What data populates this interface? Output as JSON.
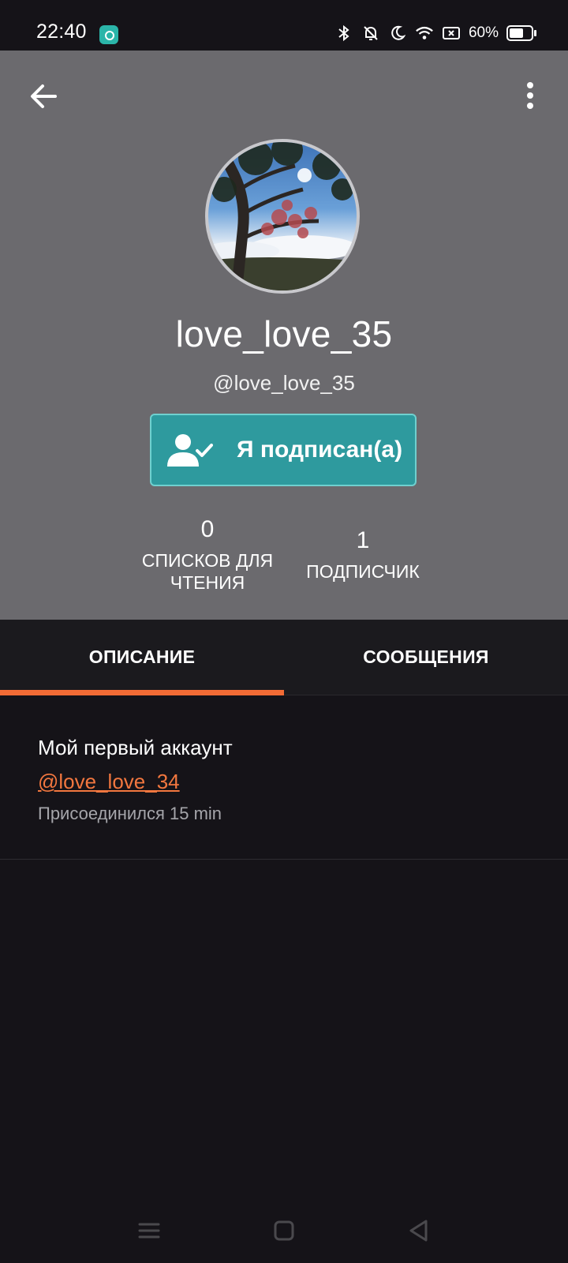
{
  "status_bar": {
    "time": "22:40",
    "battery_percent": "60%",
    "battery_level": 0.6,
    "icons": [
      "app-icon",
      "bluetooth-icon",
      "bell-off-icon",
      "moon-icon",
      "wifi-icon",
      "screen-icon",
      "battery-icon"
    ]
  },
  "profile": {
    "display_name": "love_love_35",
    "handle": "@love_love_35",
    "follow_button_label": "Я подписан(а)",
    "stats": {
      "reading_lists_count": "0",
      "reading_lists_label": "СПИСКОВ ДЛЯ ЧТЕНИЯ",
      "followers_count": "1",
      "followers_label": "ПОДПИСЧИК"
    }
  },
  "tabs": [
    {
      "label": "ОПИСАНИЕ",
      "active": true
    },
    {
      "label": "СООБЩЕНИЯ",
      "active": false
    }
  ],
  "about": {
    "text": "Мой первый аккаунт",
    "link": "@love_love_34",
    "joined": "Присоединился 15 min"
  },
  "colors": {
    "header_bg": "#6b6a6e",
    "follow_button": "#2e9a9e",
    "accent": "#f26b35",
    "background": "#151318"
  }
}
